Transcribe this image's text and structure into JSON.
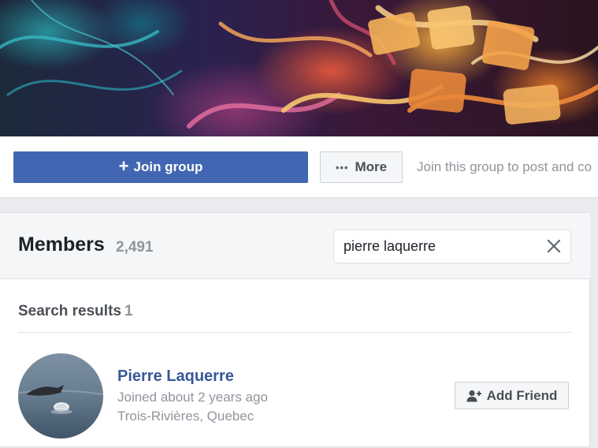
{
  "actions": {
    "join_label": "Join group",
    "join_icon": "plus-icon",
    "more_label": "More",
    "more_icon": "ellipsis-icon",
    "hint": "Join this group to post and co"
  },
  "members": {
    "title": "Members",
    "count": "2,491",
    "search": {
      "value": "pierre laquerre",
      "clear_icon": "close-icon"
    },
    "results_label": "Search results",
    "results_count": "1",
    "results": [
      {
        "name": "Pierre Laquerre",
        "joined": "Joined about 2 years ago",
        "location": "Trois-Rivières, Quebec",
        "button_label": "Add Friend",
        "button_icon": "add-friend-icon"
      }
    ]
  },
  "colors": {
    "primary": "#4267b2",
    "link": "#385898",
    "muted": "#90949c",
    "background": "#e9ebee"
  }
}
